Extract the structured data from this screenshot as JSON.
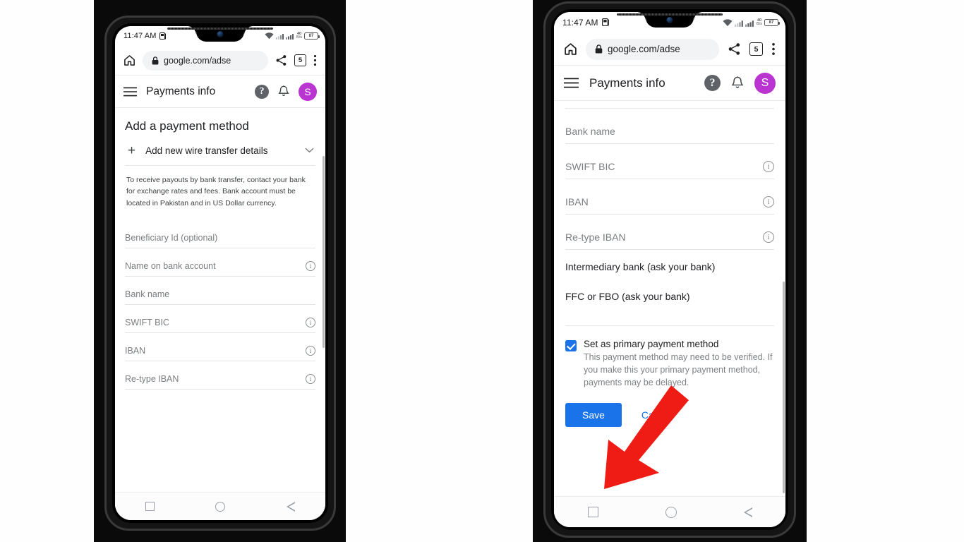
{
  "colors": {
    "accent_blue": "#1a73e8",
    "avatar_purple": "#b934d0",
    "arrow_red": "#ee1c14",
    "panel_black": "#0a0a0a"
  },
  "status_bar": {
    "time": "11:47 AM",
    "sim_icon": "dual-sim-icon",
    "wifi_icon": "wifi-icon",
    "signal_icon": "signal-bars-icon",
    "network_speed_value": "40",
    "network_speed_unit": "B/s",
    "battery_level": "87"
  },
  "browser": {
    "home_icon": "home-icon",
    "lock_icon": "lock-icon",
    "url": "google.com/adse",
    "share_icon": "share-icon",
    "tab_count": "5",
    "menu_icon": "overflow-menu-icon"
  },
  "app_header": {
    "menu_icon": "hamburger-menu-icon",
    "title": "Payments info",
    "help_icon": "help-icon",
    "help_glyph": "?",
    "notification_icon": "bell-icon",
    "avatar_icon": "avatar",
    "avatar_initial": "S"
  },
  "left_phone": {
    "page_title": "Add a payment method",
    "collapse_row": {
      "plus_glyph": "+",
      "label": "Add new wire transfer details",
      "chevron_glyph": "⌄"
    },
    "help_text": "To receive payouts by bank transfer, contact your bank for exchange rates and fees. Bank account must be located in Pakistan and in US Dollar currency.",
    "fields": [
      {
        "label": "Beneficiary Id (optional)",
        "info": false
      },
      {
        "label": "Name on bank account",
        "info": true
      },
      {
        "label": "Bank name",
        "info": false
      },
      {
        "label": "SWIFT BIC",
        "info": true
      },
      {
        "label": "IBAN",
        "info": true
      },
      {
        "label": "Re-type IBAN",
        "info": true
      }
    ]
  },
  "right_phone": {
    "fields": [
      {
        "label": "Bank name",
        "info": false
      },
      {
        "label": "SWIFT BIC",
        "info": true
      },
      {
        "label": "IBAN",
        "info": true
      },
      {
        "label": "Re-type IBAN",
        "info": true
      }
    ],
    "plain_rows": [
      "Intermediary bank (ask your bank)",
      "FFC or FBO (ask your bank)"
    ],
    "checkbox": {
      "checked": true,
      "title": "Set as primary payment method",
      "description": "This payment method may need to be verified. If you make this your primary payment method, payments may be delayed."
    },
    "actions": {
      "save_label": "Save",
      "cancel_label": "Cancel"
    }
  },
  "nav_bar": {
    "recents_icon": "square-recents-icon",
    "home_icon": "circle-home-icon",
    "back_icon": "triangle-back-icon"
  },
  "annotation": {
    "arrow_icon": "red-arrow-pointer",
    "points_at": "Save"
  }
}
